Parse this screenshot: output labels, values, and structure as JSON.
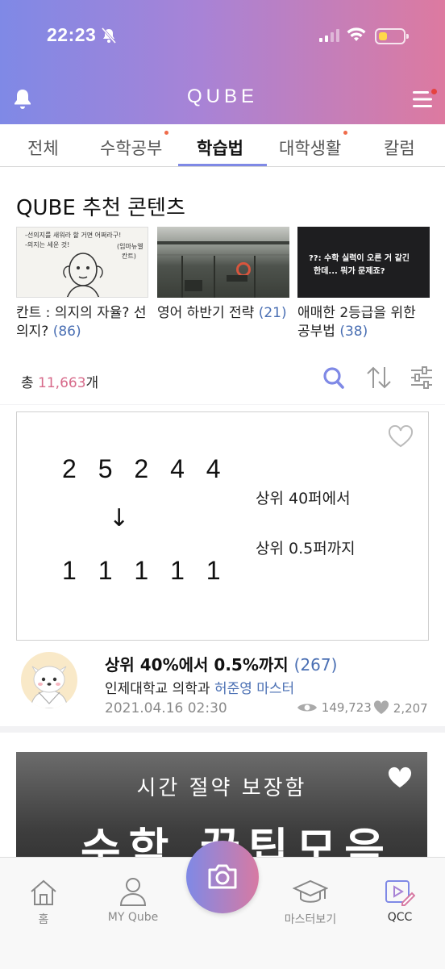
{
  "status_bar": {
    "time": "22:23"
  },
  "header": {
    "logo": "QUBE"
  },
  "tabs": [
    {
      "label": "전체",
      "dot": false
    },
    {
      "label": "수학공부",
      "dot": true
    },
    {
      "label": "학습법",
      "dot": false,
      "active": true
    },
    {
      "label": "대학생활",
      "dot": true
    },
    {
      "label": "칼럼",
      "dot": false
    }
  ],
  "recommend": {
    "title": "QUBE 추천 콘텐츠",
    "cards": [
      {
        "title": "칸트 : 의지의 자율? 선의지?",
        "count": "(86)",
        "thumb_lines": [
          "-선의지를 새워라 할 거면 어쩌라구!",
          "-의지는 세운 것!",
          "(임마뉴엘",
          "칸트)"
        ]
      },
      {
        "title": "영어 하반기 전략",
        "count": "(21)"
      },
      {
        "title": "애매한 2등급을 위한 공부법",
        "count": "(38)",
        "thumb_lines": [
          "??: 수학 실력이 오른 거 같긴",
          "한데... 뭐가 문제죠?"
        ]
      }
    ]
  },
  "total": {
    "prefix": "총 ",
    "number": "11,663",
    "suffix": "개"
  },
  "post": {
    "image": {
      "top_number": "2 5 2 4 4",
      "arrow": "↓",
      "bottom_number": "1 1 1 1 1",
      "rank_from": "상위 40퍼에서",
      "rank_to": "상위 0.5퍼까지"
    },
    "title": "상위 40%에서 0.5%까지",
    "count": "(267)",
    "school": "인제대학교 의학과",
    "author": "허준영 마스터",
    "date": "2021.04.16 02:30",
    "views": "149,723",
    "likes": "2,207"
  },
  "post2": {
    "subtitle": "시간 절약 보장함",
    "main": "수학 꿀팁모음"
  },
  "bottom_nav": [
    {
      "label": "홈"
    },
    {
      "label": "MY Qube"
    },
    {
      "label": ""
    },
    {
      "label": "마스터보기"
    },
    {
      "label": "QCC"
    }
  ],
  "colors": {
    "gradient_start": "#7f89e6",
    "gradient_end": "#dd7aa0",
    "link": "#4a6fb3",
    "count_pink": "#d76a8a"
  }
}
